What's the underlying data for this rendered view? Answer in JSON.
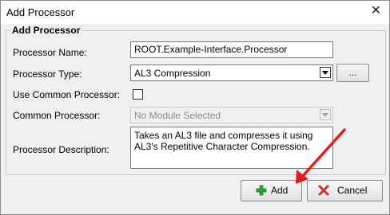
{
  "window": {
    "title": "Add Processor"
  },
  "group": {
    "legend": "Add Processor"
  },
  "form": {
    "name_label": "Processor Name:",
    "name_value": "ROOT.Example-Interface.Processor",
    "type_label": "Processor Type:",
    "type_value": "AL3 Compression",
    "browse_label": "...",
    "use_common_label": "Use Common Processor:",
    "use_common_checked": false,
    "common_label": "Common Processor:",
    "common_value": "No Module Selected",
    "desc_label": "Processor Description:",
    "desc_line1": "Takes an AL3 file and compresses it using",
    "desc_line2": "AL3's Repetitive Character Compression."
  },
  "buttons": {
    "add_label": "Add",
    "cancel_label": "Cancel"
  },
  "colors": {
    "annotation_arrow": "#e02020",
    "add_icon": "#2fa52f",
    "cancel_icon": "#d03030"
  }
}
